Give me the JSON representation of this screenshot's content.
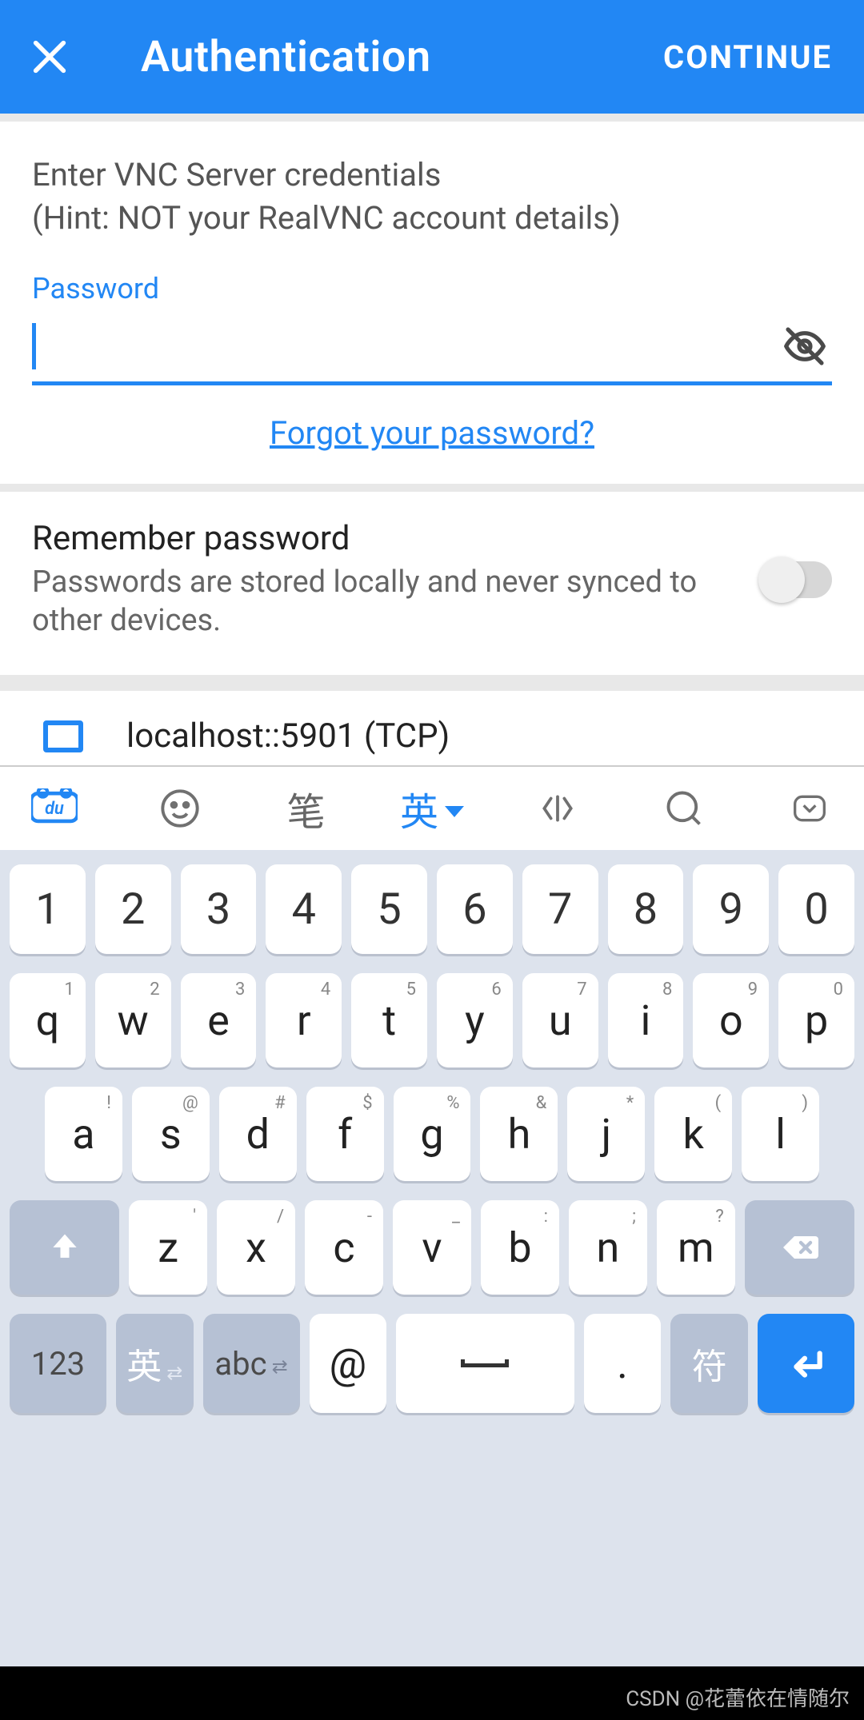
{
  "appbar": {
    "title": "Authentication",
    "continue": "CONTINUE"
  },
  "hint_line1": "Enter VNC Server credentials",
  "hint_line2": "(Hint: NOT your RealVNC account details)",
  "password_label": "Password",
  "password_value": "",
  "forgot": "Forgot your password?",
  "remember": {
    "title": "Remember password",
    "subtitle": "Passwords are stored locally and never synced to other devices."
  },
  "connection": {
    "label": "localhost::5901 (TCP)"
  },
  "keyboard": {
    "toolbar": {
      "du": "du",
      "pen": "笔",
      "lang": "英",
      "active": true
    },
    "row_num": [
      "1",
      "2",
      "3",
      "4",
      "5",
      "6",
      "7",
      "8",
      "9",
      "0"
    ],
    "row_q": [
      {
        "m": "q",
        "s": "1"
      },
      {
        "m": "w",
        "s": "2"
      },
      {
        "m": "e",
        "s": "3"
      },
      {
        "m": "r",
        "s": "4"
      },
      {
        "m": "t",
        "s": "5"
      },
      {
        "m": "y",
        "s": "6"
      },
      {
        "m": "u",
        "s": "7"
      },
      {
        "m": "i",
        "s": "8"
      },
      {
        "m": "o",
        "s": "9"
      },
      {
        "m": "p",
        "s": "0"
      }
    ],
    "row_a": [
      {
        "m": "a",
        "s": "!"
      },
      {
        "m": "s",
        "s": "@"
      },
      {
        "m": "d",
        "s": "#"
      },
      {
        "m": "f",
        "s": "$"
      },
      {
        "m": "g",
        "s": "%"
      },
      {
        "m": "h",
        "s": "&"
      },
      {
        "m": "j",
        "s": "*"
      },
      {
        "m": "k",
        "s": "("
      },
      {
        "m": "l",
        "s": ")"
      }
    ],
    "row_z": [
      {
        "m": "z",
        "s": "'"
      },
      {
        "m": "x",
        "s": "/"
      },
      {
        "m": "c",
        "s": "-"
      },
      {
        "m": "v",
        "s": "_"
      },
      {
        "m": "b",
        "s": ":"
      },
      {
        "m": "n",
        "s": ";"
      },
      {
        "m": "m",
        "s": "?"
      }
    ],
    "bottom": {
      "k123": "123",
      "klang": "英",
      "kabc": "abc",
      "kat": "@",
      "kdot": "."
    },
    "sym": "符"
  },
  "watermark": "CSDN @花蕾依在情随尔"
}
